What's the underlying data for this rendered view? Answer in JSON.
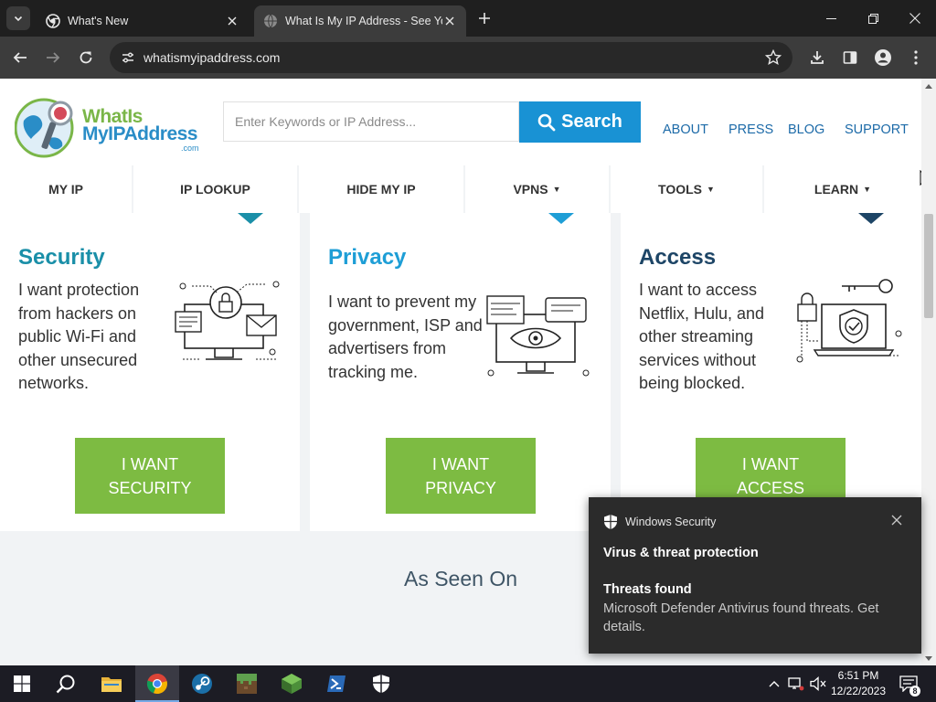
{
  "browser": {
    "tabs": [
      {
        "title": "What's New"
      },
      {
        "title": "What Is My IP Address - See You"
      }
    ],
    "url": "whatismyipaddress.com"
  },
  "site": {
    "logo": {
      "line1": "WhatIs",
      "line2": "MyIPAddress",
      "line3": ".com"
    },
    "search": {
      "placeholder": "Enter Keywords or IP Address...",
      "button": "Search"
    },
    "top_links": [
      "ABOUT",
      "PRESS",
      "BLOG",
      "SUPPORT"
    ],
    "nav": [
      {
        "label": "MY IP"
      },
      {
        "label": "IP LOOKUP"
      },
      {
        "label": "HIDE MY IP"
      },
      {
        "label": "VPNS",
        "caret": "▼"
      },
      {
        "label": "TOOLS",
        "caret": "▼"
      },
      {
        "label": "LEARN",
        "caret": "▼"
      }
    ],
    "cards": [
      {
        "title": "Security",
        "title_color": "#1a8fa8",
        "text": "I want protection from hackers on public Wi-Fi and other unsecured networks.",
        "button_line1": "I WANT",
        "button_line2": "SECURITY"
      },
      {
        "title": "Privacy",
        "title_color": "#1e9ed6",
        "text": "I want to prevent my government, ISP and advertisers from tracking me.",
        "button_line1": "I WANT",
        "button_line2": "PRIVACY"
      },
      {
        "title": "Access",
        "title_color": "#1d4566",
        "text": "I want to access Netflix, Hulu, and other streaming services without being blocked.",
        "button_line1": "I WANT",
        "button_line2": "ACCESS"
      }
    ],
    "seen_on": "As Seen On",
    "accent_green": "#7dbb42",
    "accent_blue": "#1992d4"
  },
  "toast": {
    "app": "Windows Security",
    "heading": "Virus & threat protection",
    "subheading": "Threats found",
    "body": "Microsoft Defender Antivirus found threats. Get details."
  },
  "taskbar": {
    "apps": [
      "start-icon",
      "search-icon",
      "file-explorer-icon",
      "chrome-icon",
      "steam-icon",
      "minecraft-icon",
      "minecraft-launcher-icon",
      "powershell-icon",
      "windows-security-icon"
    ],
    "time": "6:51 PM",
    "date": "12/22/2023",
    "notifications": "8"
  }
}
